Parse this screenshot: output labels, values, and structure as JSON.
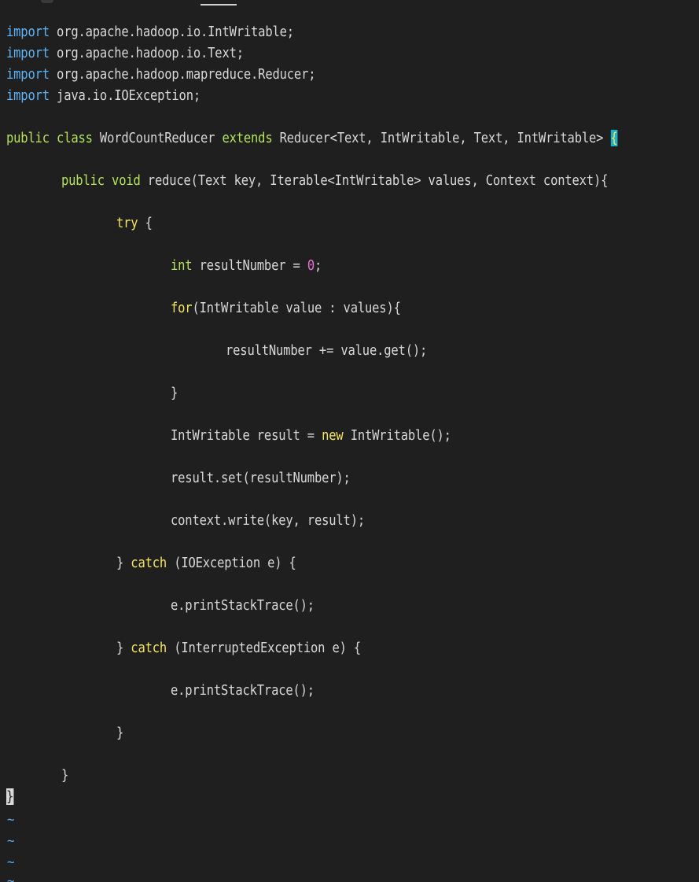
{
  "code": {
    "l1": {
      "kw": "import",
      "rest": " org.apache.hadoop.io.IntWritable;"
    },
    "l2": {
      "kw": "import",
      "rest": " org.apache.hadoop.io.Text;"
    },
    "l3": {
      "kw": "import",
      "rest": " org.apache.hadoop.mapreduce.Reducer;"
    },
    "l4": {
      "kw": "import",
      "rest": " java.io.IOException;"
    },
    "l5": {
      "kw1": "public",
      "sp1": " ",
      "kw2": "class",
      "name": " WordCountReducer ",
      "kw3": "extends",
      "rest": " Reducer<Text, IntWritable, Text, IntWritable> ",
      "brace": "{"
    },
    "l6": {
      "kw1": "public",
      "sp1": " ",
      "kw2": "void",
      "rest": " reduce(Text key, Iterable<IntWritable> values, Context context){"
    },
    "l7": {
      "kw": "try",
      "rest": " {"
    },
    "l8": {
      "kw": "int",
      "rest1": " resultNumber = ",
      "num": "0",
      "rest2": ";"
    },
    "l9": {
      "kw": "for",
      "rest": "(IntWritable value : values){"
    },
    "l10": {
      "text": "resultNumber += value.get();"
    },
    "l11": {
      "text": "}"
    },
    "l12": {
      "rest1": "IntWritable result = ",
      "kw": "new",
      "rest2": " IntWritable();"
    },
    "l13": {
      "text": "result.set(resultNumber);"
    },
    "l14": {
      "text": "context.write(key, result);"
    },
    "l15": {
      "pre": "} ",
      "kw": "catch",
      "rest": " (IOException e) {"
    },
    "l16": {
      "text": "e.printStackTrace();"
    },
    "l17": {
      "pre": "} ",
      "kw": "catch",
      "rest": " (InterruptedException e) {"
    },
    "l18": {
      "text": "e.printStackTrace();"
    },
    "l19": {
      "text": "}"
    },
    "l20": {
      "text": "}"
    },
    "l21": {
      "text": "}"
    }
  },
  "empty_line_marker": "~",
  "colors": {
    "background": "#1f1f1f",
    "keyword_import": "#5fb3f6",
    "keyword_type": "#b6e35d",
    "keyword_control": "#f2e463",
    "number": "#e86fd6",
    "text": "#d8d8d8",
    "cursor": "#1eaec8"
  }
}
